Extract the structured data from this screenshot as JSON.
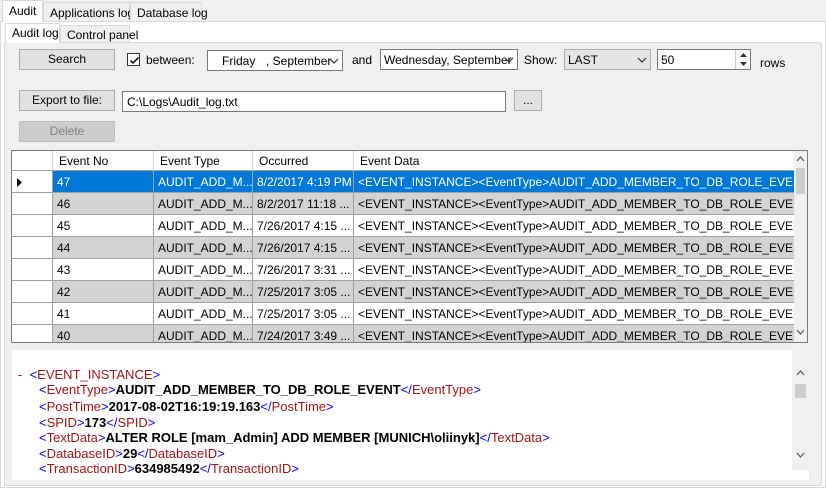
{
  "outer_tabs": [
    "Audit",
    "Applications log",
    "Database log"
  ],
  "inner_tabs": [
    "Audit log",
    "Control panel"
  ],
  "filter": {
    "search_label": "Search",
    "between_label": "between:",
    "between_checked": true,
    "from_day": "Friday",
    "from_month": ", September",
    "and_label": "and",
    "to_date": "Wednesday, September",
    "show_label": "Show:",
    "show_value": "LAST",
    "rows_value": "50",
    "rows_label": "rows"
  },
  "export": {
    "button_label": "Export to file:",
    "path": "C:\\Logs\\Audit_log.txt",
    "browse_label": "..."
  },
  "delete_label": "Delete",
  "grid": {
    "columns": [
      "Event No",
      "Event Type",
      "Occurred",
      "Event Data"
    ],
    "rows": [
      {
        "no": "47",
        "type": "AUDIT_ADD_M...",
        "occurred": "8/2/2017 4:19 PM",
        "data": "<EVENT_INSTANCE><EventType>AUDIT_ADD_MEMBER_TO_DB_ROLE_EVENT</..."
      },
      {
        "no": "46",
        "type": "AUDIT_ADD_M...",
        "occurred": "8/2/2017 11:18 ...",
        "data": "<EVENT_INSTANCE><EventType>AUDIT_ADD_MEMBER_TO_DB_ROLE_EVENT</..."
      },
      {
        "no": "45",
        "type": "AUDIT_ADD_M...",
        "occurred": "7/26/2017 4:15 ...",
        "data": "<EVENT_INSTANCE><EventType>AUDIT_ADD_MEMBER_TO_DB_ROLE_EVENT</..."
      },
      {
        "no": "44",
        "type": "AUDIT_ADD_M...",
        "occurred": "7/26/2017 4:15 ...",
        "data": "<EVENT_INSTANCE><EventType>AUDIT_ADD_MEMBER_TO_DB_ROLE_EVENT</..."
      },
      {
        "no": "43",
        "type": "AUDIT_ADD_M...",
        "occurred": "7/26/2017 3:31 ...",
        "data": "<EVENT_INSTANCE><EventType>AUDIT_ADD_MEMBER_TO_DB_ROLE_EVENT</..."
      },
      {
        "no": "42",
        "type": "AUDIT_ADD_M...",
        "occurred": "7/25/2017 3:05 ...",
        "data": "<EVENT_INSTANCE><EventType>AUDIT_ADD_MEMBER_TO_DB_ROLE_EVENT</..."
      },
      {
        "no": "41",
        "type": "AUDIT_ADD_M...",
        "occurred": "7/25/2017 3:05 ...",
        "data": "<EVENT_INSTANCE><EventType>AUDIT_ADD_MEMBER_TO_DB_ROLE_EVENT</..."
      },
      {
        "no": "40",
        "type": "AUDIT_ADD_M...",
        "occurred": "7/24/2017 3:49 ...",
        "data": "<EVENT_INSTANCE><EventType>AUDIT_ADD_MEMBER_TO_DB_ROLE_EVENT</..."
      }
    ]
  },
  "xml": {
    "collapse_glyph": "-",
    "root_tag": "EVENT_INSTANCE",
    "fields": [
      {
        "tag": "EventType",
        "value": "AUDIT_ADD_MEMBER_TO_DB_ROLE_EVENT"
      },
      {
        "tag": "PostTime",
        "value": "2017-08-02T16:19:19.163"
      },
      {
        "tag": "SPID",
        "value": "173"
      },
      {
        "tag": "TextData",
        "value": "ALTER ROLE [mam_Admin] ADD MEMBER [MUNICH\\oliinyk]"
      },
      {
        "tag": "DatabaseID",
        "value": "29"
      },
      {
        "tag": "TransactionID",
        "value": "634985492"
      }
    ]
  },
  "colors": {
    "selection": "#0078d7",
    "alt_row": "#d3d3d3",
    "xml_tag": "#a31515",
    "xml_bracket": "#0000ff"
  }
}
